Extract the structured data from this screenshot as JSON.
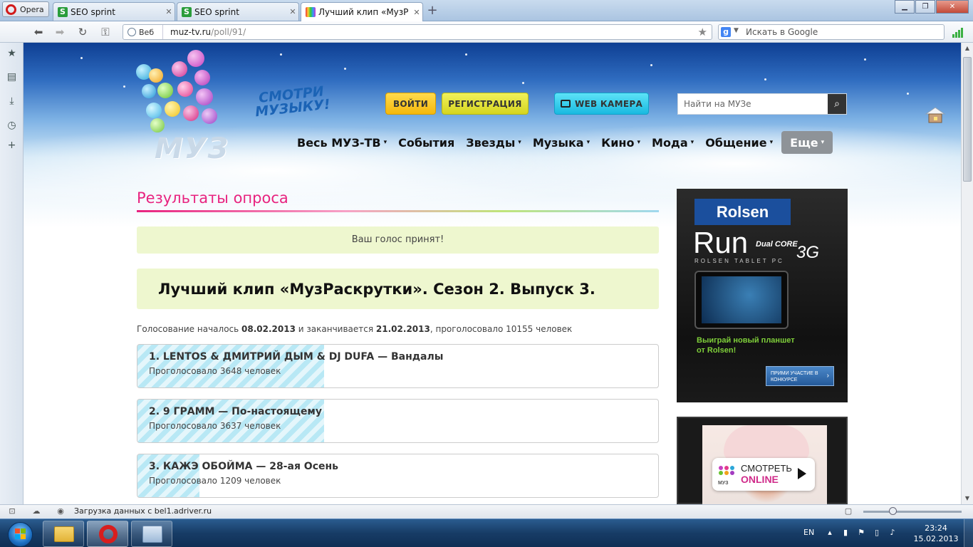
{
  "browser": {
    "menu_label": "Opera",
    "tabs": [
      {
        "title": "SEO sprint",
        "favicon": "S"
      },
      {
        "title": "SEO sprint",
        "favicon": "S"
      },
      {
        "title": "Лучший клип «МузРа..."
      }
    ],
    "web_button": "Веб",
    "url_host": "muz-tv.ru",
    "url_path": "/poll/91/",
    "search_placeholder": "Искать в Google",
    "search_engine_letter": "g"
  },
  "site": {
    "logo_text": "МУЗ",
    "slogan_line1": "СМОТРИ",
    "slogan_line2": "МУЗЫКУ!",
    "login_label": "ВОЙТИ",
    "register_label": "РЕГИСТРАЦИЯ",
    "webcam_label": "WEB КАМЕРА",
    "search_placeholder": "Найти на МУЗе",
    "nav": [
      {
        "label": "Весь МУЗ-ТВ",
        "caret": "▾"
      },
      {
        "label": "События",
        "caret": ""
      },
      {
        "label": "Звезды",
        "caret": "▾"
      },
      {
        "label": "Музыка",
        "caret": "▾"
      },
      {
        "label": "Кино",
        "caret": "▾"
      },
      {
        "label": "Мода",
        "caret": "▾"
      },
      {
        "label": "Общение",
        "caret": "▾"
      },
      {
        "label": "Еще",
        "caret": "▾"
      }
    ]
  },
  "poll": {
    "page_title": "Результаты опроса",
    "notice": "Ваш голос принят!",
    "heading": "Лучший клип «МузРаскрутки». Сезон 2. Выпуск 3.",
    "meta_prefix": "Голосование началось",
    "start_date": "08.02.2013",
    "meta_middle": "и заканчивается",
    "end_date": "21.02.2013",
    "meta_suffix": ", проголосовало 10155 человек",
    "answers": [
      {
        "title": "1. LENTOS & ДМИТРИЙ ДЫМ & DJ DUFA — Вандалы",
        "count_text": "Проголосовало 3648 человек",
        "share": 0.359
      },
      {
        "title": "2. 9 ГРАММ — По-настоящему",
        "count_text": "Проголосовало 3637 человек",
        "share": 0.358
      },
      {
        "title": "3. КАЖЭ ОБОЙМА — 28-ая Осень",
        "count_text": "Проголосовало 1209 человек",
        "share": 0.119
      }
    ]
  },
  "ads": {
    "rolsen_brand": "Rolsen",
    "rolsen_model": "Run",
    "rolsen_dualcore": "Dual CORE",
    "rolsen_3g": "3G",
    "rolsen_tablet": "ROLSEN TABLET PC",
    "rolsen_promo": "Выиграй новый планшет от Rolsen!",
    "rolsen_cta": "ПРИМИ УЧАСТИЕ В КОНКУРСЕ",
    "online_watch": "СМОТРЕТЬ",
    "online_label": "ONLINE",
    "online_logo": "МУЗ"
  },
  "status": {
    "loading_text": "Загрузка данных с bel1.adriver.ru"
  },
  "taskbar": {
    "lang": "EN",
    "time": "23:24",
    "date": "15.02.2013"
  },
  "colors": {
    "accent_pink": "#e8237f",
    "notice_bg": "#eef7cf",
    "bar_stripe": "#b8e8f5",
    "login_yellow": "#f5b80c",
    "webcam_cyan": "#19b9e0"
  }
}
